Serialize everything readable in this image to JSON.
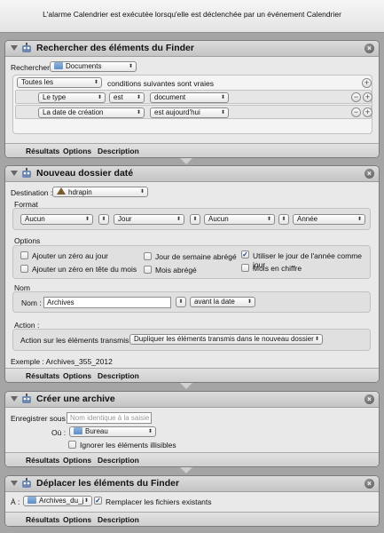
{
  "header": {
    "text": "L'alarme Calendrier est exécutée lorsqu'elle est déclenchée par un événement Calendrier"
  },
  "footer_tabs": [
    "Résultats",
    "Options",
    "Description"
  ],
  "action1": {
    "title": "Rechercher des éléments du Finder",
    "search_label": "Rechercher",
    "search_location": "Documents",
    "match_mode": "Toutes les",
    "match_suffix": "conditions suivantes sont vraies",
    "rows": [
      {
        "field": "Le type",
        "op": "est",
        "value": "document"
      },
      {
        "field": "La date de création",
        "op": "est aujourd'hui",
        "value": ""
      }
    ]
  },
  "action2": {
    "title": "Nouveau dossier daté",
    "destination_label": "Destination :",
    "destination_value": "hdrapin",
    "format_label": "Format",
    "format_values": [
      "Aucun",
      "Jour",
      "Aucun",
      "Année"
    ],
    "options_label": "Options",
    "options": [
      {
        "label": "Ajouter un zéro au jour",
        "checked": false
      },
      {
        "label": "Ajouter un zéro en tête du mois",
        "checked": false
      },
      {
        "label": "Jour de semaine abrégé",
        "checked": false
      },
      {
        "label": "Mois abrégé",
        "checked": false
      },
      {
        "label": "Utiliser le jour de l'année comme jour",
        "checked": true
      },
      {
        "label": "Mois en chiffre",
        "checked": false
      }
    ],
    "name_group_label": "Nom",
    "name_label": "Nom :",
    "name_value": "Archives",
    "name_position": "avant la date",
    "action_group_label": "Action :",
    "action_label": "Action sur les éléments transmis :",
    "action_value": "Dupliquer les éléments transmis dans le nouveau dossier",
    "example": "Exemple : Archives_355_2012"
  },
  "action3": {
    "title": "Créer une archive",
    "save_label": "Enregistrer sous :",
    "save_placeholder": "Nom identique à la saisie",
    "where_label": "Où :",
    "where_value": "Bureau",
    "ignore_label": "Ignorer les éléments illisibles",
    "ignore_checked": false
  },
  "action4": {
    "title": "Déplacer les éléments du Finder",
    "to_label": "À :",
    "to_value": "Archives_du_j",
    "replace_label": "Remplacer les fichiers existants",
    "replace_checked": true
  },
  "colors": {
    "background": "#a5a5a5",
    "panel": "#e9e9e9",
    "titlebar": "#cfcfcf"
  },
  "icons": [
    "automator-robot-icon",
    "close-icon",
    "folder-icon",
    "home-icon",
    "disclosure-triangle-icon",
    "checkmark-icon"
  ]
}
